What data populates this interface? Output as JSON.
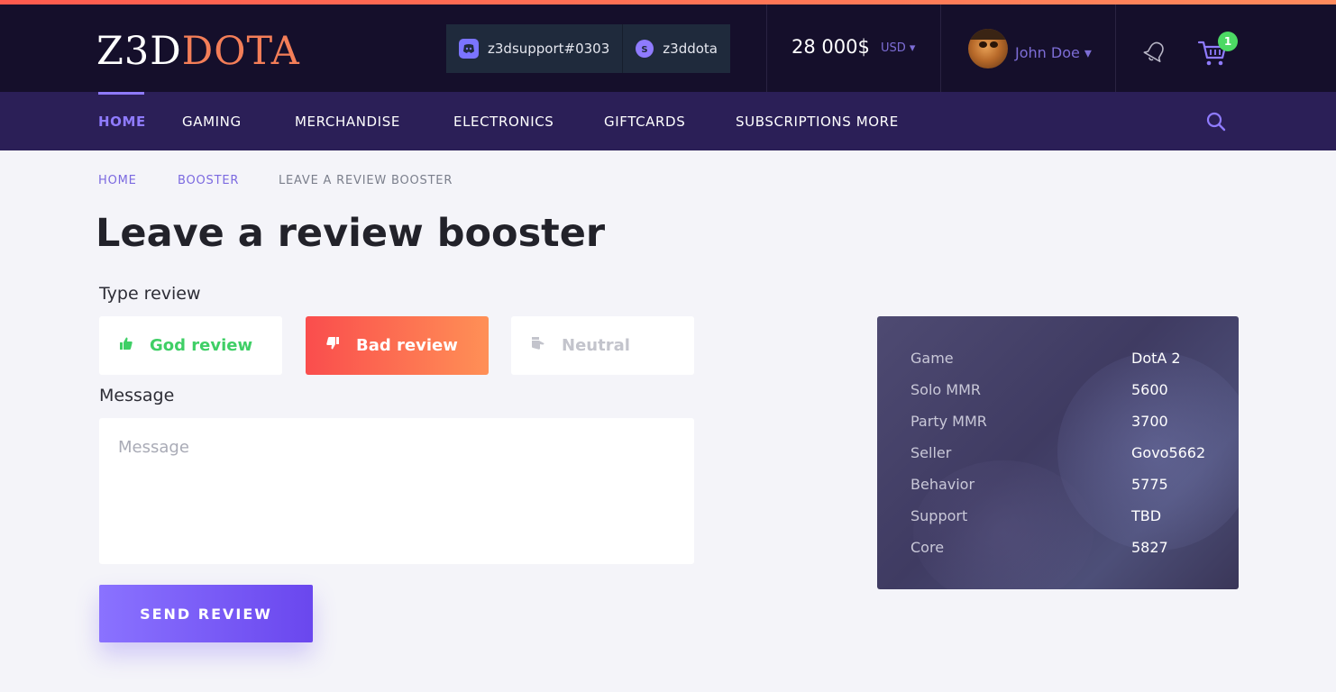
{
  "header": {
    "logo_part1": "Z3D",
    "logo_part2": "DOTA",
    "contacts": [
      {
        "icon": "discord-icon",
        "label": "z3dsupport#0303"
      },
      {
        "icon": "skype-icon",
        "label": "z3ddota"
      }
    ],
    "balance": "28 000$",
    "currency": "USD ▾",
    "user_name": "John Doe ▾",
    "cart_count": "1"
  },
  "nav": {
    "items": [
      "HOME",
      "GAMING",
      "MERCHANDISE",
      "ELECTRONICS",
      "GIFTCARDS",
      "SUBSCRIPTIONS MORE"
    ],
    "active_index": 0
  },
  "breadcrumb": [
    "HOME",
    "BOOSTER",
    "LEAVE A REVIEW BOOSTER"
  ],
  "page_title": "Leave a review booster",
  "form": {
    "type_label": "Type review",
    "review_types": [
      {
        "label": "God review",
        "icon": "thumbs-up-icon"
      },
      {
        "label": "Bad review",
        "icon": "thumbs-down-icon",
        "selected": true
      },
      {
        "label": "Neutral",
        "icon": "thumbs-neutral-icon"
      }
    ],
    "message_label": "Message",
    "message_placeholder": "Message",
    "submit_label": "SEND REVIEW"
  },
  "info": [
    {
      "key": "Game",
      "value": "DotA 2"
    },
    {
      "key": "Solo MMR",
      "value": "5600"
    },
    {
      "key": "Party MMR",
      "value": "3700"
    },
    {
      "key": "Seller",
      "value": "Govo5662"
    },
    {
      "key": "Behavior",
      "value": "5775"
    },
    {
      "key": "Support",
      "value": "TBD"
    },
    {
      "key": "Core",
      "value": "5827"
    }
  ],
  "colors": {
    "accent": "#8f7bff",
    "header_bg": "#150f2b",
    "nav_bg": "#2b1f57",
    "good": "#3fcf66",
    "bad_start": "#fa4d4d",
    "bad_end": "#ff9056"
  }
}
